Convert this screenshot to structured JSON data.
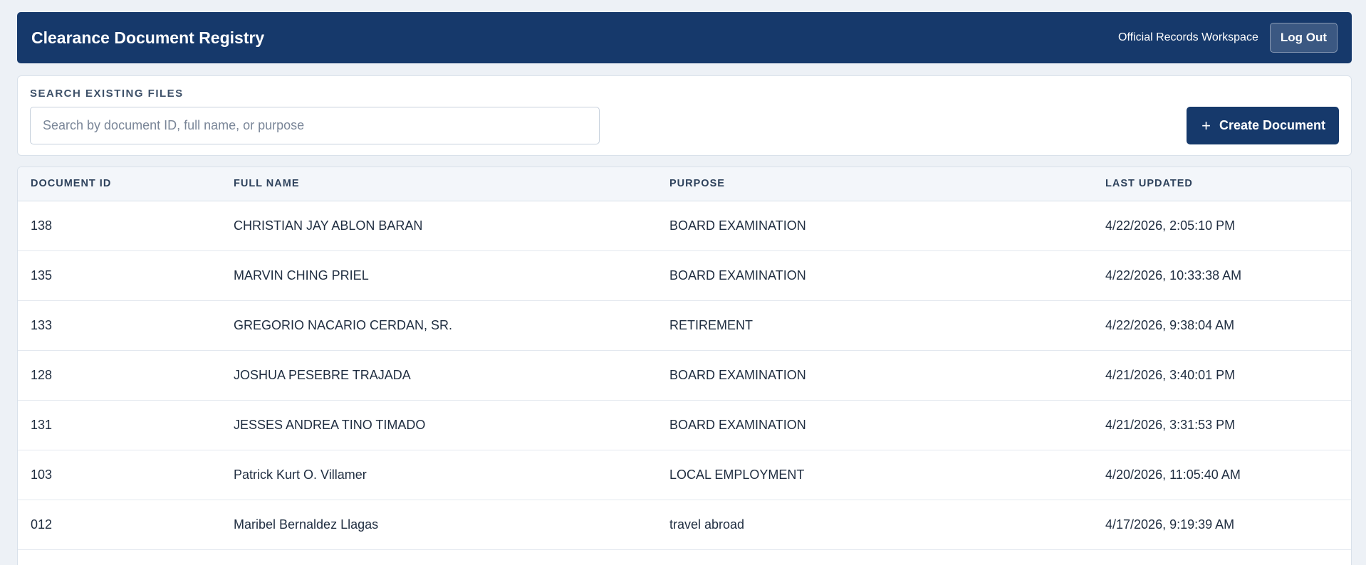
{
  "header": {
    "title": "Clearance Document Registry",
    "workspace": "Official Records Workspace",
    "logout_label": "Log Out"
  },
  "search": {
    "label": "SEARCH EXISTING FILES",
    "placeholder": "Search by document ID, full name, or purpose",
    "value": "",
    "create_label": "Create Document",
    "create_icon": "plus-icon"
  },
  "table": {
    "columns": [
      "DOCUMENT ID",
      "FULL NAME",
      "PURPOSE",
      "LAST UPDATED"
    ],
    "rows": [
      {
        "id": "138",
        "name": "CHRISTIAN JAY ABLON BARAN",
        "purpose": "BOARD EXAMINATION",
        "updated": "4/22/2026, 2:05:10 PM"
      },
      {
        "id": "135",
        "name": "MARVIN CHING PRIEL",
        "purpose": "BOARD EXAMINATION",
        "updated": "4/22/2026, 10:33:38 AM"
      },
      {
        "id": "133",
        "name": "GREGORIO NACARIO CERDAN, SR.",
        "purpose": "RETIREMENT",
        "updated": "4/22/2026, 9:38:04 AM"
      },
      {
        "id": "128",
        "name": "JOSHUA PESEBRE TRAJADA",
        "purpose": "BOARD EXAMINATION",
        "updated": "4/21/2026, 3:40:01 PM"
      },
      {
        "id": "131",
        "name": "JESSES ANDREA TINO TIMADO",
        "purpose": "BOARD EXAMINATION",
        "updated": "4/21/2026, 3:31:53 PM"
      },
      {
        "id": "103",
        "name": "Patrick Kurt O. Villamer",
        "purpose": "LOCAL EMPLOYMENT",
        "updated": "4/20/2026, 11:05:40 AM"
      },
      {
        "id": "012",
        "name": "Maribel Bernaldez Llagas",
        "purpose": "travel abroad",
        "updated": "4/17/2026, 9:19:39 AM"
      }
    ]
  },
  "colors": {
    "primary": "#16396b",
    "background": "#edf1f6",
    "header_row": "#f3f6fa"
  }
}
